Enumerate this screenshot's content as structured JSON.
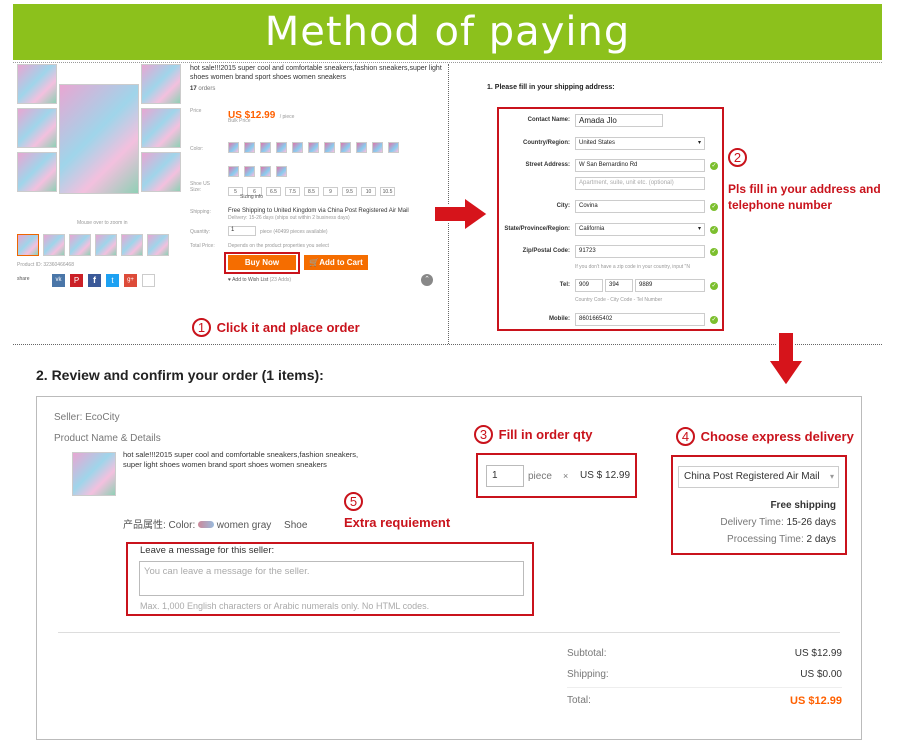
{
  "banner": {
    "title": "Method of paying"
  },
  "product_page": {
    "title": "hot sale!!!2015 super cool and comfortable sneakers,fashion sneakers,super light shoes women brand sport shoes women sneakers",
    "orders_count": "17",
    "orders_label": "orders",
    "price_label": "Price",
    "price": "US $12.99",
    "price_unit": "/ piece",
    "bulk_price": "Bulk Price",
    "color_label": "Color:",
    "shoe_size_label": "Shoe US Size:",
    "sizes": [
      "5",
      "6",
      "6.5",
      "7.5",
      "8.5",
      "9",
      "9.5",
      "10",
      "10.5"
    ],
    "sizing_info": "Sizing info",
    "shipping_label": "Shipping:",
    "shipping_text": "Free Shipping to United Kingdom via China Post Registered Air Mail",
    "delivery_text": "Delivery: 15-26 days (ships out within 2 business days)",
    "quantity_label": "Quantity:",
    "quantity_value": "1",
    "quantity_note": "piece (40499 pieces available)",
    "total_label": "Total Price:",
    "total_note": "Depends on the product properties you select",
    "buy_now": "Buy Now",
    "add_to_cart": "Add to Cart",
    "wishlist": "Add to Wish List",
    "wishlist_count": "(23 Adds)",
    "mouse_hint": "Mouse over to zoom in",
    "product_id": "Product ID: 32360466468",
    "share_label": "share"
  },
  "step1": {
    "label": "Click it and place order",
    "num": "1"
  },
  "shipping_form": {
    "heading": "1. Please fill in your shipping address:",
    "fields": {
      "contact_label": "Contact Name:",
      "contact_value": "Amada  Jlo",
      "country_label": "Country/Region:",
      "country_value": "United States",
      "street_label": "Street Address:",
      "street_value": "W San Bernardino Rd",
      "street2_placeholder": "Apartment, suite, unit etc. (optional)",
      "city_label": "City:",
      "city_value": "Covina",
      "state_label": "State/Province/Region:",
      "state_value": "California",
      "zip_label": "Zip/Postal Code:",
      "zip_value": "91723",
      "zip_note": "If you don't have a zip code in your country, input \"N",
      "tel_label": "Tel:",
      "tel_1": "909",
      "tel_2": "394",
      "tel_3": "9889",
      "tel_note": "Country Code - City Code - Tel Number",
      "mobile_label": "Mobile:",
      "mobile_value": "8601665402"
    }
  },
  "step2": {
    "num": "2",
    "label_line1": "Pls fill in your address and",
    "label_line2": "telephone number"
  },
  "review": {
    "heading": "2. Review and confirm your order (1 items):",
    "seller": "Seller: EcoCity",
    "product_header": "Product Name & Details",
    "product_title_1": "hot sale!!!2015 super cool and comfortable sneakers,fashion sneakers,",
    "product_title_2": "super light shoes women brand sport shoes women sneakers",
    "attr_label": "产品属性: Color:",
    "attr_color": "women gray",
    "attr_type": "Shoe",
    "qty_value": "1",
    "qty_unit": "piece",
    "times": "×",
    "unit_price": "US $ 12.99",
    "shipping_method": "China Post Registered Air Mail",
    "free_shipping": "Free shipping",
    "delivery_time_label": "Delivery Time:",
    "delivery_time": "15-26 days",
    "processing_time_label": "Processing Time:",
    "processing_time": "2 days",
    "message_label": "Leave a message for this seller:",
    "message_placeholder": "You can leave a message for the seller.",
    "message_hint": "Max. 1,000 English characters or Arabic numerals only. No HTML codes.",
    "subtotal_label": "Subtotal:",
    "subtotal": "US $12.99",
    "shipping_label": "Shipping:",
    "shipping": "US $0.00",
    "total_label": "Total:",
    "total": "US $12.99"
  },
  "step3": {
    "num": "3",
    "label": "Fill in order qty"
  },
  "step4": {
    "num": "4",
    "label": "Choose express delivery"
  },
  "step5": {
    "num": "5",
    "label": "Extra requiement"
  },
  "colors": {
    "banner": "#8cc11c",
    "annotation_red": "#c9131c",
    "price_orange": "#ff6000",
    "check_green": "#7cbf2e"
  }
}
